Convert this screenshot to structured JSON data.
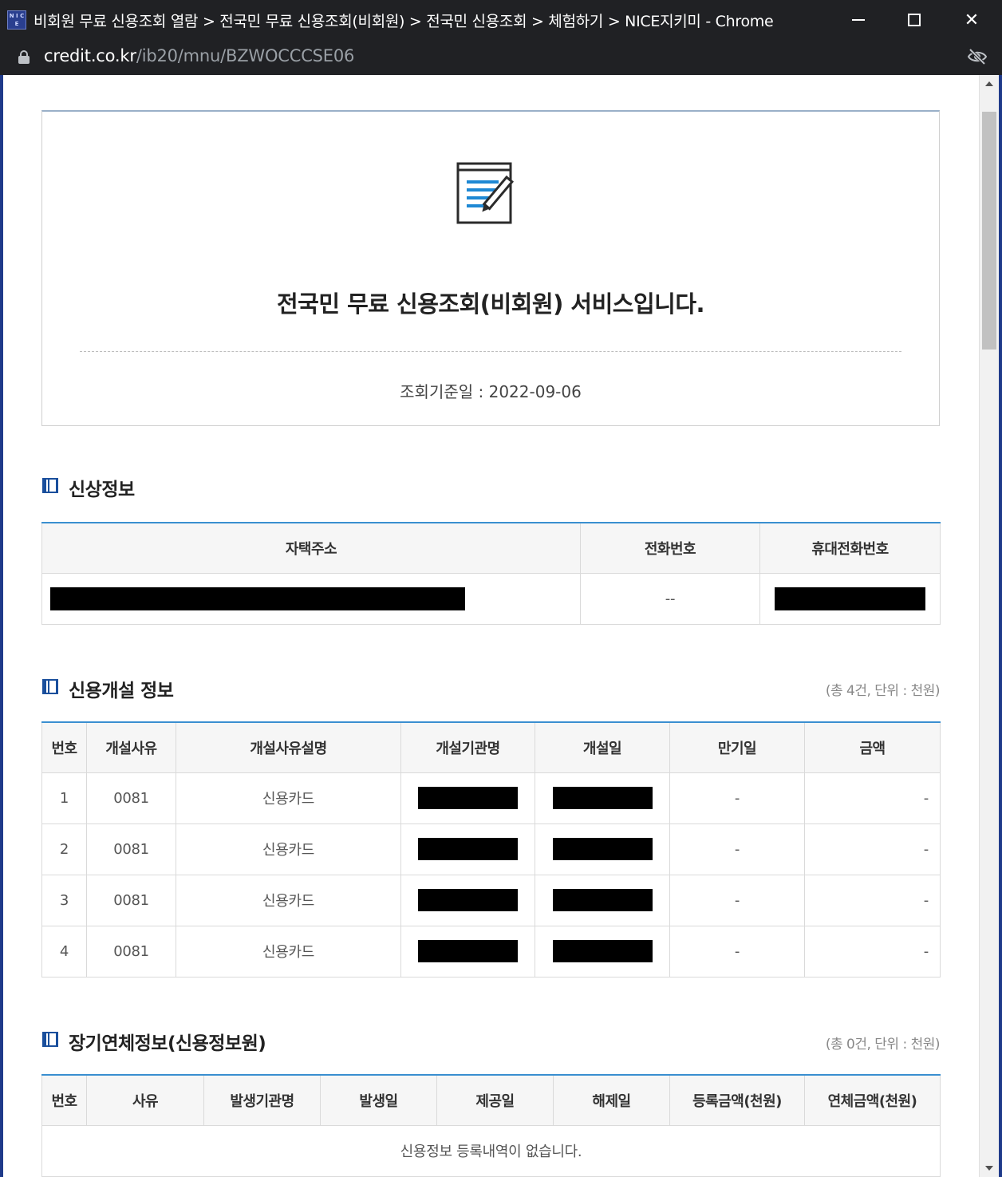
{
  "window": {
    "app_icon_text": "N I C E",
    "title": "비회원 무료 신용조회 열람 > 전국민 무료 신용조회(비회원) > 전국민 신용조회 > 체험하기 > NICE지키미 - Chrome",
    "url_host": "credit.co.kr",
    "url_path": "/ib20/mnu/BZWOCCCSE06",
    "minimize_icon": "minimize-icon",
    "maximize_icon": "maximize-icon",
    "close_label": "✕"
  },
  "hero": {
    "icon": "document-edit-icon",
    "title": "전국민 무료 신용조회(비회원) 서비스입니다.",
    "date_text": "조회기준일 : 2022-09-06"
  },
  "personal": {
    "title": "신상정보",
    "headers": [
      "자택주소",
      "전화번호",
      "휴대전화번호"
    ],
    "phone_value": "--"
  },
  "credit_open": {
    "title": "신용개설 정보",
    "note": "(총 4건, 단위 : 천원)",
    "headers": [
      "번호",
      "개설사유",
      "개설사유설명",
      "개설기관명",
      "개설일",
      "만기일",
      "금액"
    ],
    "rows": [
      {
        "no": "1",
        "code": "0081",
        "desc": "신용카드",
        "due": "-",
        "amount": "-"
      },
      {
        "no": "2",
        "code": "0081",
        "desc": "신용카드",
        "due": "-",
        "amount": "-"
      },
      {
        "no": "3",
        "code": "0081",
        "desc": "신용카드",
        "due": "-",
        "amount": "-"
      },
      {
        "no": "4",
        "code": "0081",
        "desc": "신용카드",
        "due": "-",
        "amount": "-"
      }
    ]
  },
  "overdue": {
    "title": "장기연체정보(신용정보원)",
    "note": "(총 0건, 단위 : 천원)",
    "headers": [
      "번호",
      "사유",
      "발생기관명",
      "발생일",
      "제공일",
      "해제일",
      "등록금액(천원)",
      "연체금액(천원)"
    ],
    "empty_message": "신용정보 등록내역이 없습니다."
  }
}
